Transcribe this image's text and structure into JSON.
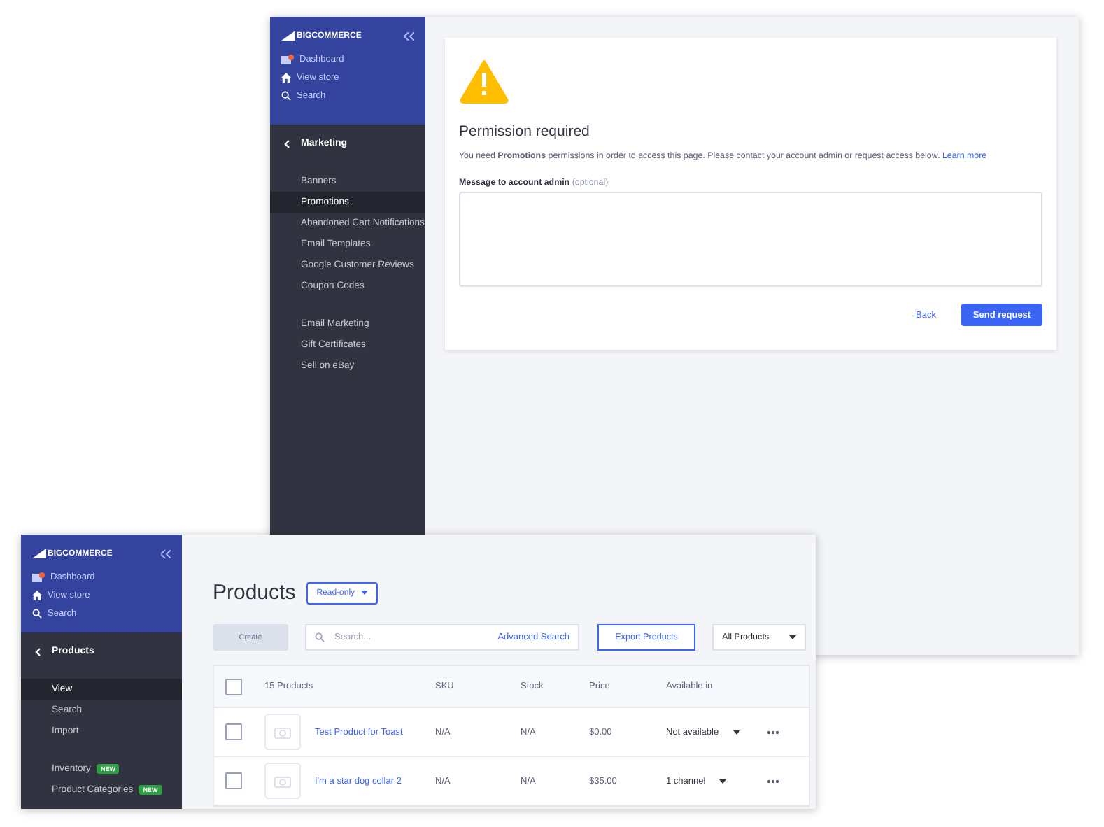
{
  "permission_window": {
    "sidebar": {
      "logo": "BIGCOMMERCE",
      "top_links": [
        {
          "kind": "dashboard",
          "label": "Dashboard"
        },
        {
          "kind": "store",
          "label": "View store"
        },
        {
          "kind": "search",
          "label": "Search"
        }
      ],
      "section": "Marketing",
      "groups": [
        [
          {
            "label": "Banners",
            "selected": false
          },
          {
            "label": "Promotions",
            "selected": true
          },
          {
            "label": "Abandoned Cart Notifications",
            "selected": false
          },
          {
            "label": "Email Templates",
            "selected": false
          },
          {
            "label": "Google Customer Reviews",
            "selected": false
          },
          {
            "label": "Coupon Codes",
            "selected": false
          }
        ],
        [
          {
            "label": "Email Marketing",
            "selected": false
          },
          {
            "label": "Gift Certificates",
            "selected": false
          },
          {
            "label": "Sell on eBay",
            "selected": false
          }
        ]
      ]
    },
    "card": {
      "title": "Permission required",
      "message": "You need **Promotions** permissions in order to access this page. Please contact your account admin or request access below.",
      "link": "Learn more",
      "field_label": "Message to account admin",
      "field_hint": "(optional)",
      "back": "Back",
      "submit": "Send request"
    }
  },
  "products_window": {
    "sidebar": {
      "logo": "BIGCOMMERCE",
      "top_links": [
        {
          "kind": "dashboard",
          "label": "Dashboard"
        },
        {
          "kind": "store",
          "label": "View store"
        },
        {
          "kind": "search",
          "label": "Search"
        }
      ],
      "section": "Products",
      "groups": [
        [
          {
            "label": "View",
            "selected": true
          },
          {
            "label": "Search",
            "selected": false
          },
          {
            "label": "Import",
            "selected": false
          }
        ],
        [
          {
            "label": "Inventory",
            "selected": false,
            "badge": "NEW"
          },
          {
            "label": "Product Categories",
            "selected": false,
            "badge": "NEW"
          }
        ]
      ]
    },
    "title": "Products",
    "status": "Read-only",
    "create": {
      "label": "Create",
      "disabled": true
    },
    "search": {
      "placeholder": "Search...",
      "link": "Advanced Search"
    },
    "export": "Export Products",
    "filter": "All Products",
    "table": {
      "count": "15 Products",
      "columns": [
        "SKU",
        "Stock",
        "Price",
        "Available in"
      ],
      "header_checked": false,
      "rows": [
        {
          "name": "Test Product for Toast",
          "sku": "N/A",
          "stock": "N/A",
          "price": "$0.00",
          "available": "Not available",
          "checked": false
        },
        {
          "name": "I'm a star dog collar 2",
          "sku": "N/A",
          "stock": "N/A",
          "price": "$35.00",
          "available": "1 channel",
          "checked": false
        }
      ]
    }
  }
}
